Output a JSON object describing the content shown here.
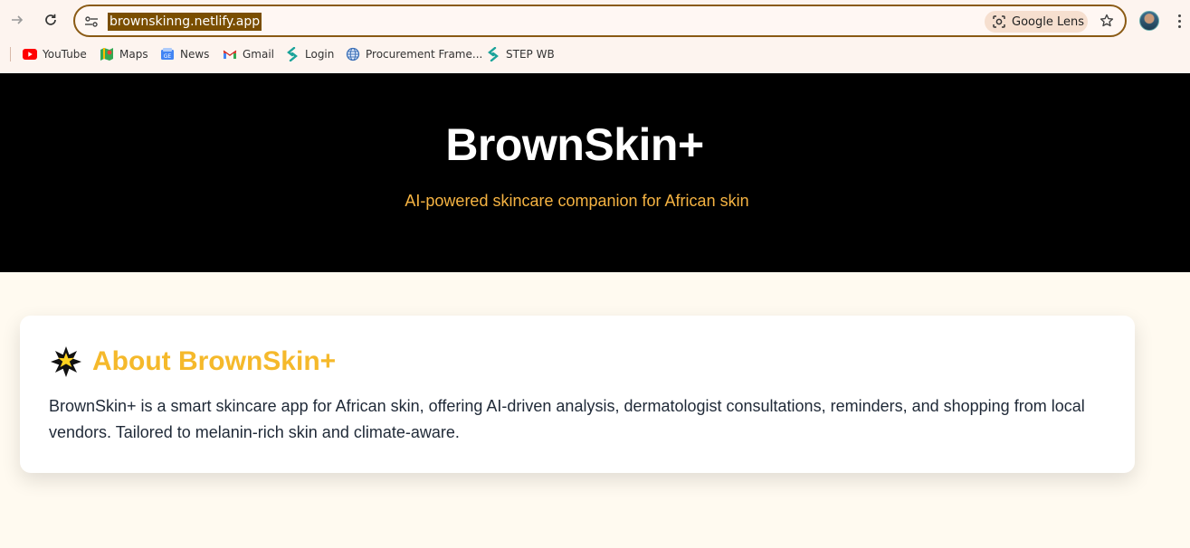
{
  "browser": {
    "url": "brownskinng.netlify.app",
    "lens_label": "Google Lens",
    "bookmarks": [
      {
        "label": "YouTube",
        "icon": "youtube-icon"
      },
      {
        "label": "Maps",
        "icon": "maps-icon"
      },
      {
        "label": "News",
        "icon": "news-icon"
      },
      {
        "label": "Gmail",
        "icon": "gmail-icon"
      },
      {
        "label": "Login",
        "icon": "login-icon"
      },
      {
        "label": "Procurement Frame...",
        "icon": "globe-icon"
      },
      {
        "label": "STEP WB",
        "icon": "step-icon"
      }
    ]
  },
  "hero": {
    "title": "BrownSkin+",
    "subtitle": "AI-powered skincare companion for African skin"
  },
  "about": {
    "icon": "sparkle-star-icon",
    "title": "About BrownSkin+",
    "text": "BrownSkin+ is a smart skincare app for African skin, offering AI-driven analysis, dermatologist consultations, reminders, and shopping from local vendors. Tailored to melanin-rich skin and climate-aware."
  },
  "colors": {
    "hero_bg": "#000000",
    "accent": "#f5b92b",
    "page_bg": "#fffaf0"
  }
}
